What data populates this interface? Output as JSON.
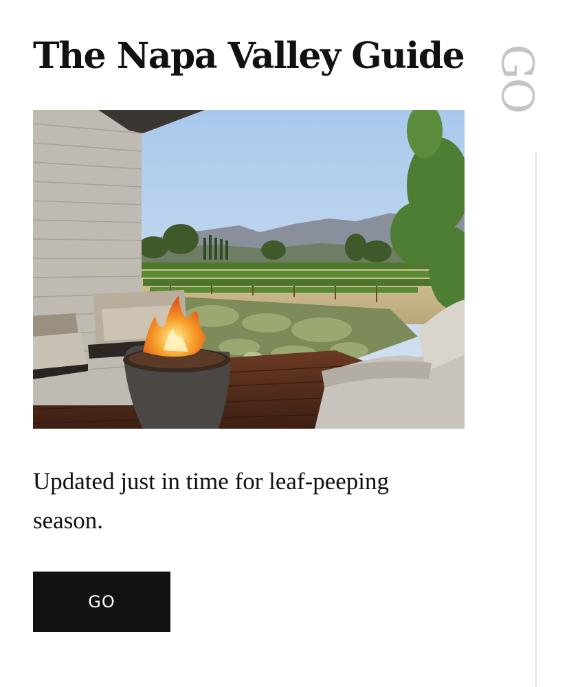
{
  "article": {
    "title": "The Napa Valley Guide",
    "dek": "Updated just in time for leaf-peeping season.",
    "cta_label": "GO"
  },
  "side": {
    "label": "GO"
  },
  "colors": {
    "text": "#111111",
    "button_bg": "#121212",
    "button_text": "#ffffff",
    "side_label": "#c4c4c4",
    "rule": "#e2e2e2"
  }
}
